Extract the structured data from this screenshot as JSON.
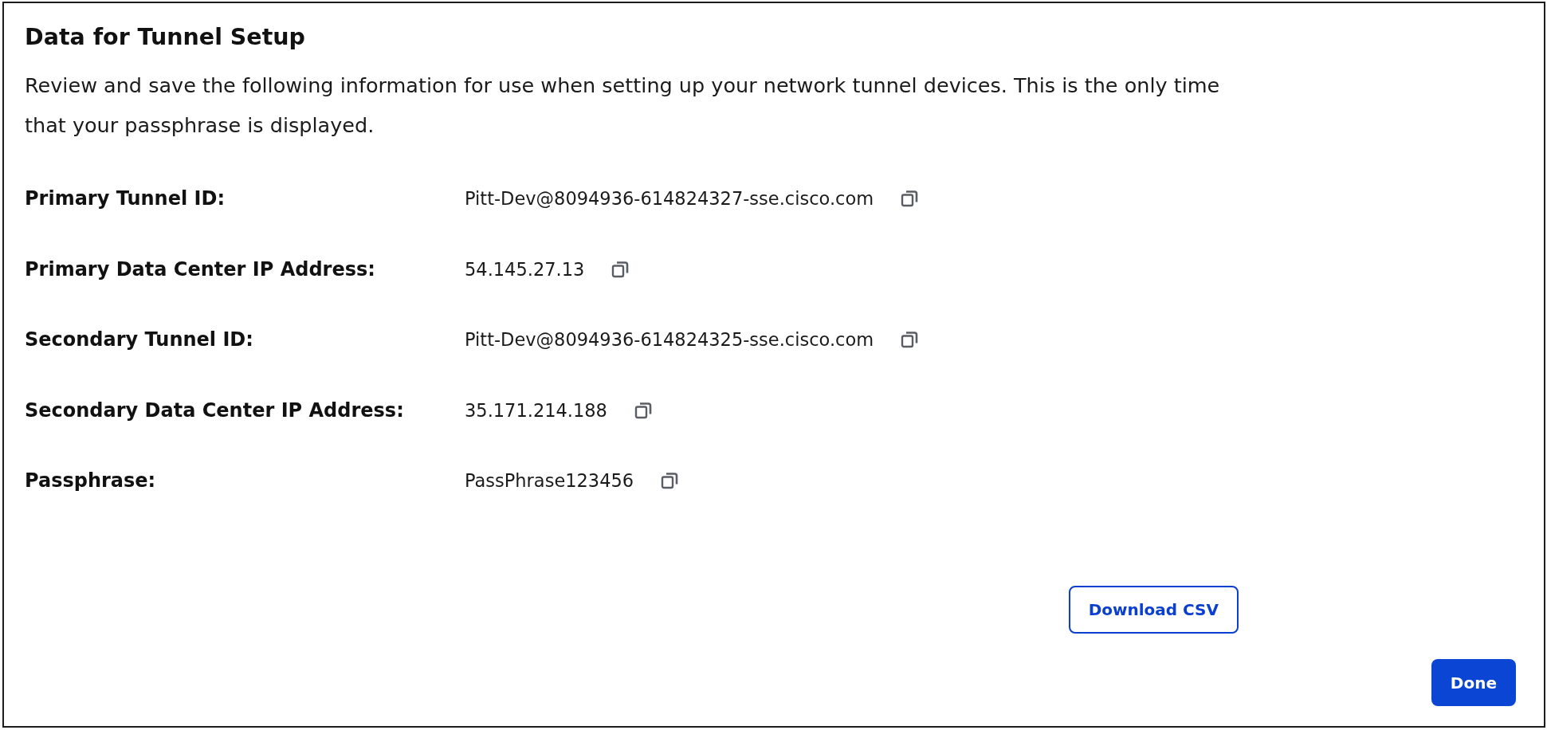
{
  "dialog": {
    "title": "Data for Tunnel Setup",
    "description": "Review and save the following information for use when setting up your network tunnel devices. This is the only time that your passphrase is displayed."
  },
  "fields": [
    {
      "label": "Primary Tunnel ID:",
      "value": "Pitt-Dev@8094936-614824327-sse.cisco.com"
    },
    {
      "label": "Primary Data Center IP Address:",
      "value": "54.145.27.13"
    },
    {
      "label": "Secondary Tunnel ID:",
      "value": "Pitt-Dev@8094936-614824325-sse.cisco.com"
    },
    {
      "label": "Secondary Data Center IP Address:",
      "value": "35.171.214.188"
    },
    {
      "label": "Passphrase:",
      "value": "PassPhrase123456"
    }
  ],
  "buttons": [
    {
      "label": "Download CSV",
      "kind": "secondary"
    },
    {
      "label": "Done",
      "kind": "primary"
    }
  ]
}
